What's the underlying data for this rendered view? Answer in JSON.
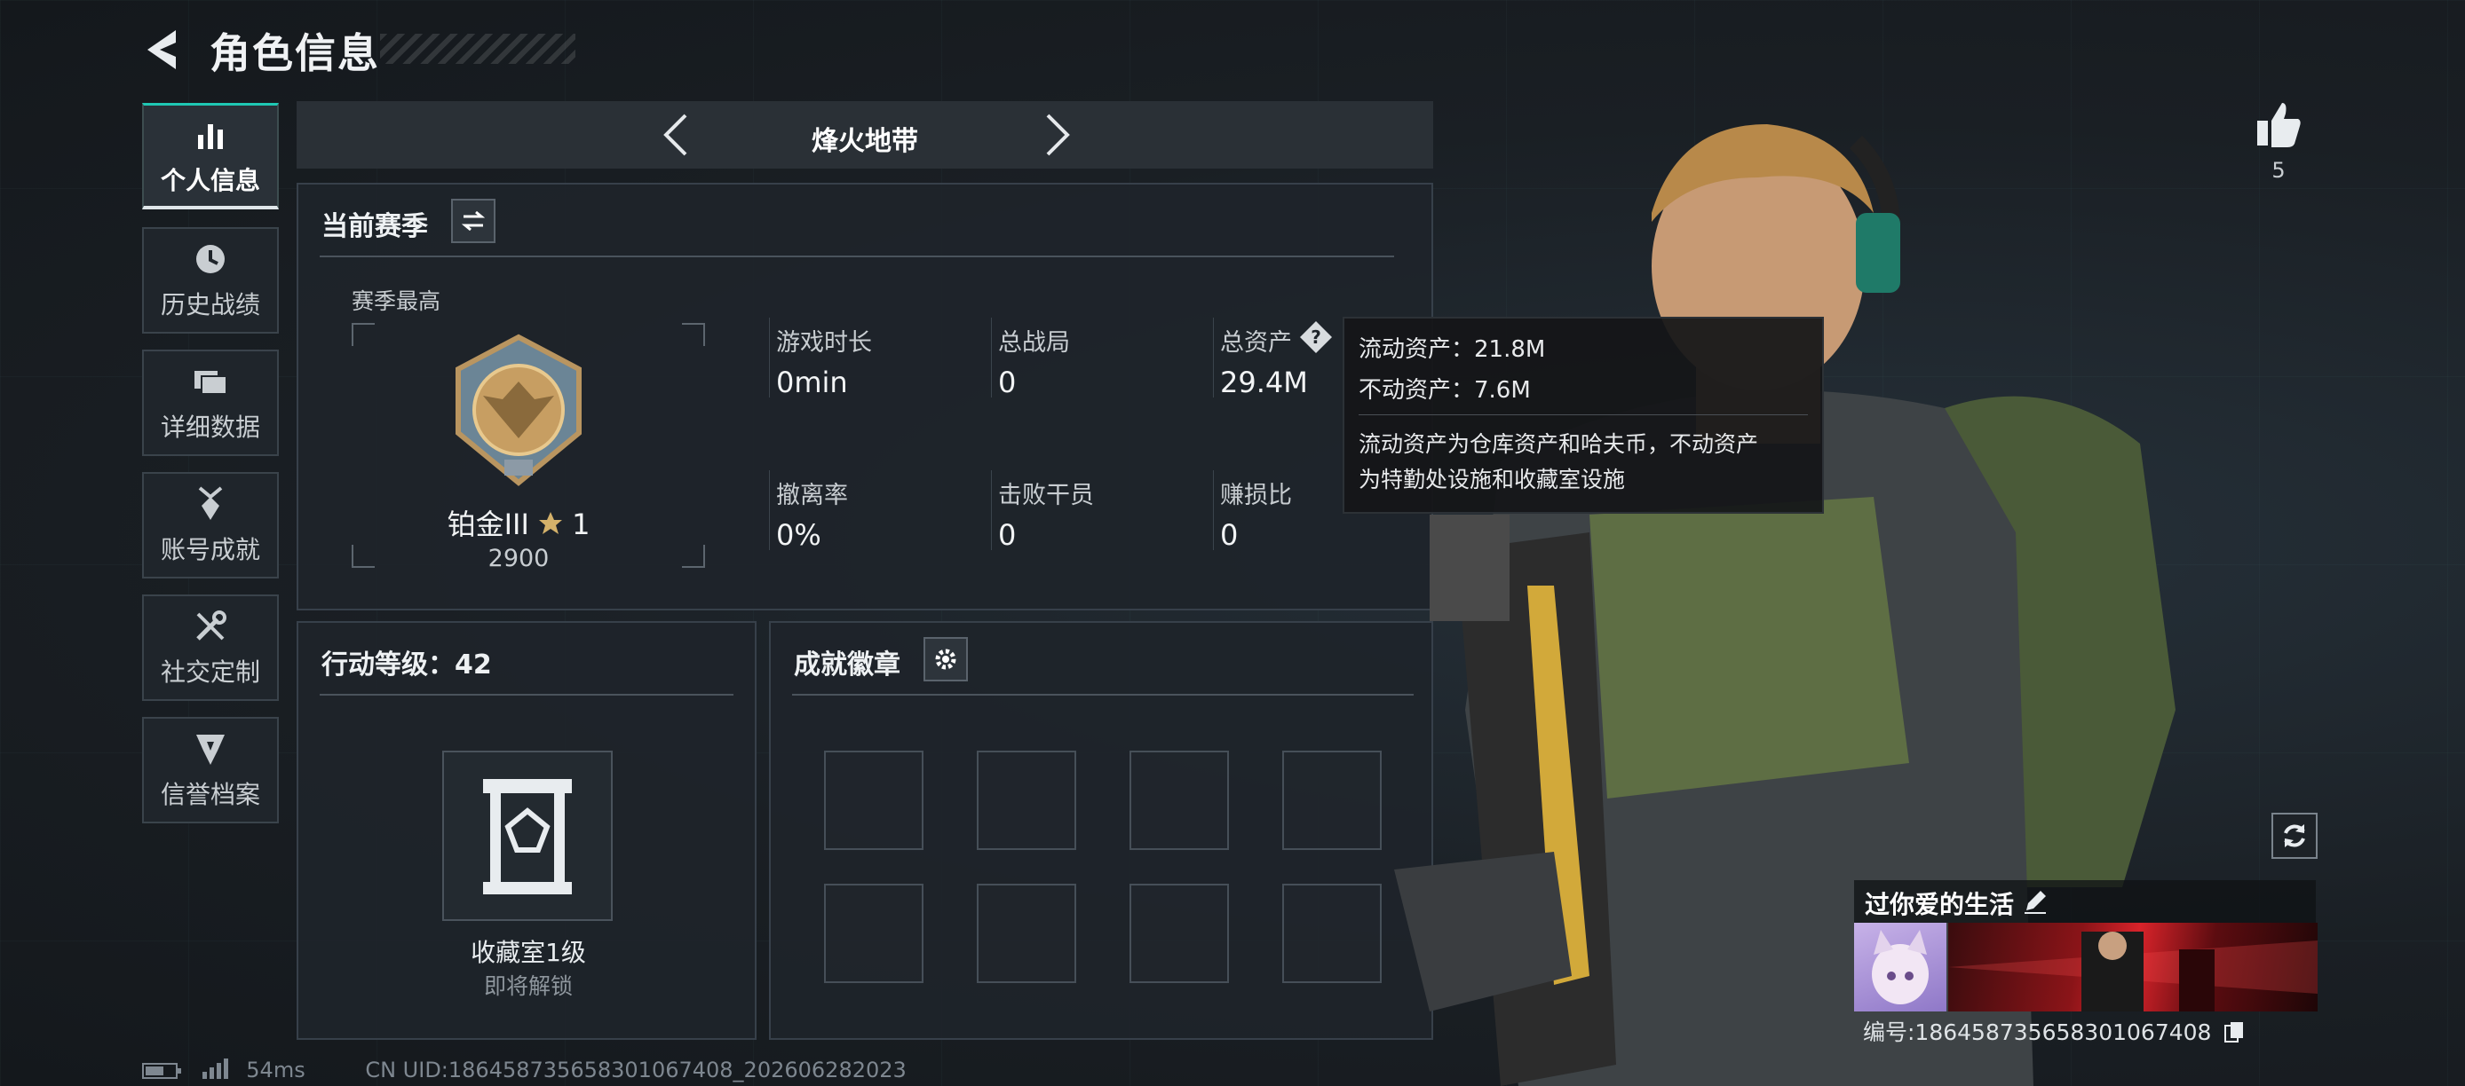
{
  "header": {
    "title": "角色信息",
    "back_icon": "back-arrow-icon"
  },
  "sidebar": {
    "items": [
      {
        "label": "个人信息",
        "icon": "bar-chart-icon",
        "active": true
      },
      {
        "label": "历史战绩",
        "icon": "clock-icon",
        "active": false
      },
      {
        "label": "详细数据",
        "icon": "folder-icon",
        "active": false
      },
      {
        "label": "账号成就",
        "icon": "medal-icon",
        "active": false
      },
      {
        "label": "社交定制",
        "icon": "tools-icon",
        "active": false
      },
      {
        "label": "信誉档案",
        "icon": "shield-icon",
        "active": false
      }
    ]
  },
  "mode_selector": {
    "title": "烽火地带"
  },
  "season": {
    "title": "当前赛季",
    "best_label": "赛季最高",
    "rank_name": "铂金III",
    "rank_stars": "1",
    "rank_score": "2900",
    "stats": [
      {
        "label": "游戏时长",
        "value": "0min"
      },
      {
        "label": "总战局",
        "value": "0"
      },
      {
        "label": "总资产",
        "value": "29.4M"
      },
      {
        "label": "撤离率",
        "value": "0%"
      },
      {
        "label": "击败干员",
        "value": "0"
      },
      {
        "label": "赚损比",
        "value": "0"
      }
    ]
  },
  "tooltip": {
    "liquid": "流动资产：21.8M",
    "fixed": "不动资产：7.6M",
    "desc1": "流动资产为仓库资产和哈夫币，不动资产",
    "desc2": "为特勤处设施和收藏室设施"
  },
  "action_level": {
    "title": "行动等级：42",
    "item_name": "收藏室1级",
    "item_status": "即将解锁"
  },
  "achievements": {
    "title": "成就徽章",
    "slot_count": 8
  },
  "character": {
    "like_count": "5",
    "card_title": "过你爱的生活",
    "uid_text": "编号:18645873565830106740​8"
  },
  "status": {
    "ping": "54ms",
    "uid": "CN UID:18645873565830106740​8_20260628​2023"
  },
  "colors": {
    "accent": "#1fc8b4",
    "panel": "#1e242a",
    "border": "#37404a"
  }
}
